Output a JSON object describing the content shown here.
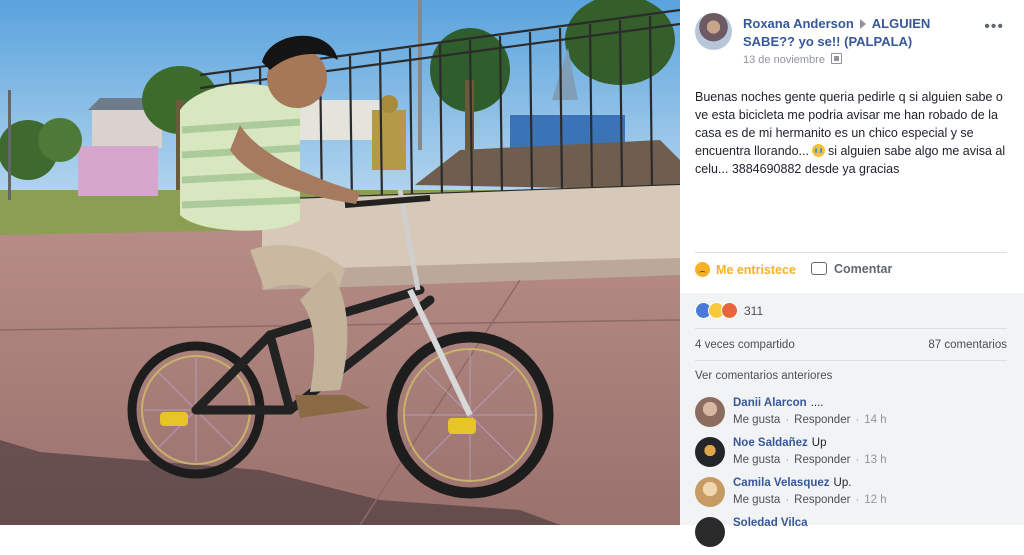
{
  "post": {
    "author": "Roxana Anderson",
    "group": "ALGUIEN SABE?? yo se!! (PALPALA)",
    "date": "13 de noviembre",
    "text_part1": "Buenas noches gente queria pedirle q si alguien sabe o ve esta bicicleta me podria avisar me han robado de la casa es de mi hermanito es un chico especial y se encuentra llorando...",
    "text_part2": "si alguien sabe algo me avisa al celu... 3884690882 desde ya gracias"
  },
  "actions": {
    "react_label": "Me entristece",
    "comment_label": "Comentar"
  },
  "stats": {
    "reaction_count": "311",
    "shares": "4 veces compartido",
    "comments": "87 comentarios",
    "previous_comments": "Ver comentarios anteriores"
  },
  "comments": [
    {
      "name": "Danii Alarcon",
      "text": "....",
      "like": "Me gusta",
      "reply": "Responder",
      "time": "14 h"
    },
    {
      "name": "Noe Saldañez",
      "text": "Up",
      "like": "Me gusta",
      "reply": "Responder",
      "time": "13 h"
    },
    {
      "name": "Camila Velasquez",
      "text": "Up.",
      "like": "Me gusta",
      "reply": "Responder",
      "time": "12 h"
    },
    {
      "name": "Soledad Vilca",
      "text": "",
      "like": "",
      "reply": "",
      "time": ""
    }
  ],
  "icons": {
    "more": "more-options-icon",
    "privacy": "globe-icon",
    "react": "sad-reaction-icon",
    "comment": "comment-icon"
  },
  "colors": {
    "link_blue": "#365899",
    "reaction_yellow": "#f7b125",
    "secondary_gray": "#90949c"
  }
}
